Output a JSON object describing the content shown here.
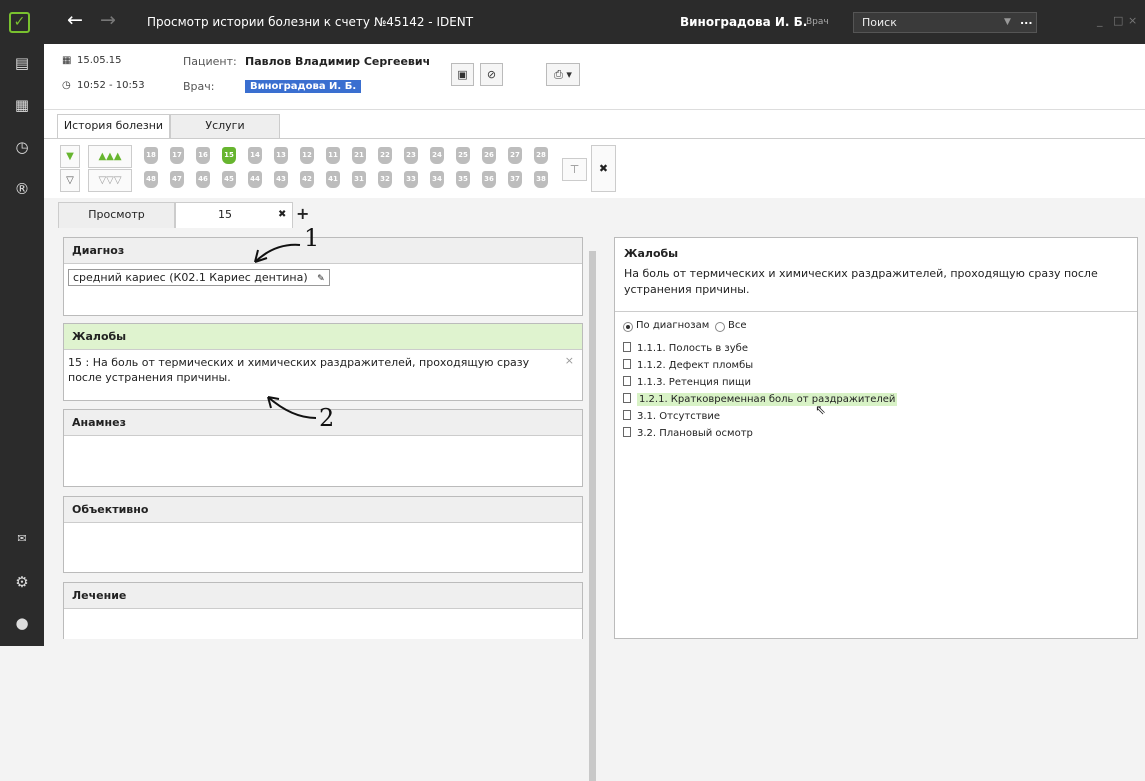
{
  "window": {
    "title": "Просмотр истории болезни к счету №45142 - IDENT",
    "user_name": "Виноградова И. Б.",
    "user_role": "Врач",
    "search_placeholder": "Поиск",
    "search_more": "...",
    "ctrl_min": "_",
    "ctrl_max": "□",
    "ctrl_close": "×"
  },
  "header": {
    "date": "15.05.15",
    "time": "10:52 - 10:53",
    "patient_label": "Пациент:",
    "patient_name": "Павлов Владимир Сергеевич",
    "doctor_label": "Врач:",
    "doctor_name": "Виноградова И. Б."
  },
  "tabs": [
    "История болезни",
    "Услуги"
  ],
  "teeth": {
    "upper": [
      "18",
      "17",
      "16",
      "15",
      "14",
      "13",
      "12",
      "11",
      "21",
      "22",
      "23",
      "24",
      "25",
      "26",
      "27",
      "28"
    ],
    "lower": [
      "48",
      "47",
      "46",
      "45",
      "44",
      "43",
      "42",
      "41",
      "31",
      "32",
      "33",
      "34",
      "35",
      "36",
      "37",
      "38"
    ],
    "selected": "15"
  },
  "subtabs": {
    "view": "Просмотр",
    "tooth": "15",
    "close": "✖",
    "add": "+"
  },
  "sections": {
    "diagnosis": {
      "title": "Диагноз",
      "value": "средний кариес (К02.1 Кариес дентина)"
    },
    "complaints": {
      "title": "Жалобы",
      "value": "15 : На боль от термических и химических раздражителей, проходящую сразу после устранения причины.",
      "close": "×"
    },
    "anamnesis": {
      "title": "Анамнез"
    },
    "objective": {
      "title": "Объективно"
    },
    "treatment": {
      "title": "Лечение"
    }
  },
  "right_panel": {
    "title": "Жалобы",
    "text": "На боль от термических и химических раздражителей, проходящую сразу после устранения причины.",
    "radio_by_diag": "По диагнозам",
    "radio_all": "Все",
    "items": [
      "1.1.1. Полость в зубе",
      "1.1.2. Дефект пломбы",
      "1.1.3. Ретенция пищи",
      "1.2.1. Кратковременная боль от раздражителей",
      "3.1. Отсутствие",
      "3.2. Плановый осмотр"
    ],
    "highlighted_index": 3
  },
  "annotations": [
    "1",
    "2"
  ],
  "colors": {
    "accent_green": "#67b52f",
    "dark_chrome": "#2b2b2b",
    "doctor_blue": "#3a6fd0",
    "highlight": "#d8f2c6"
  }
}
